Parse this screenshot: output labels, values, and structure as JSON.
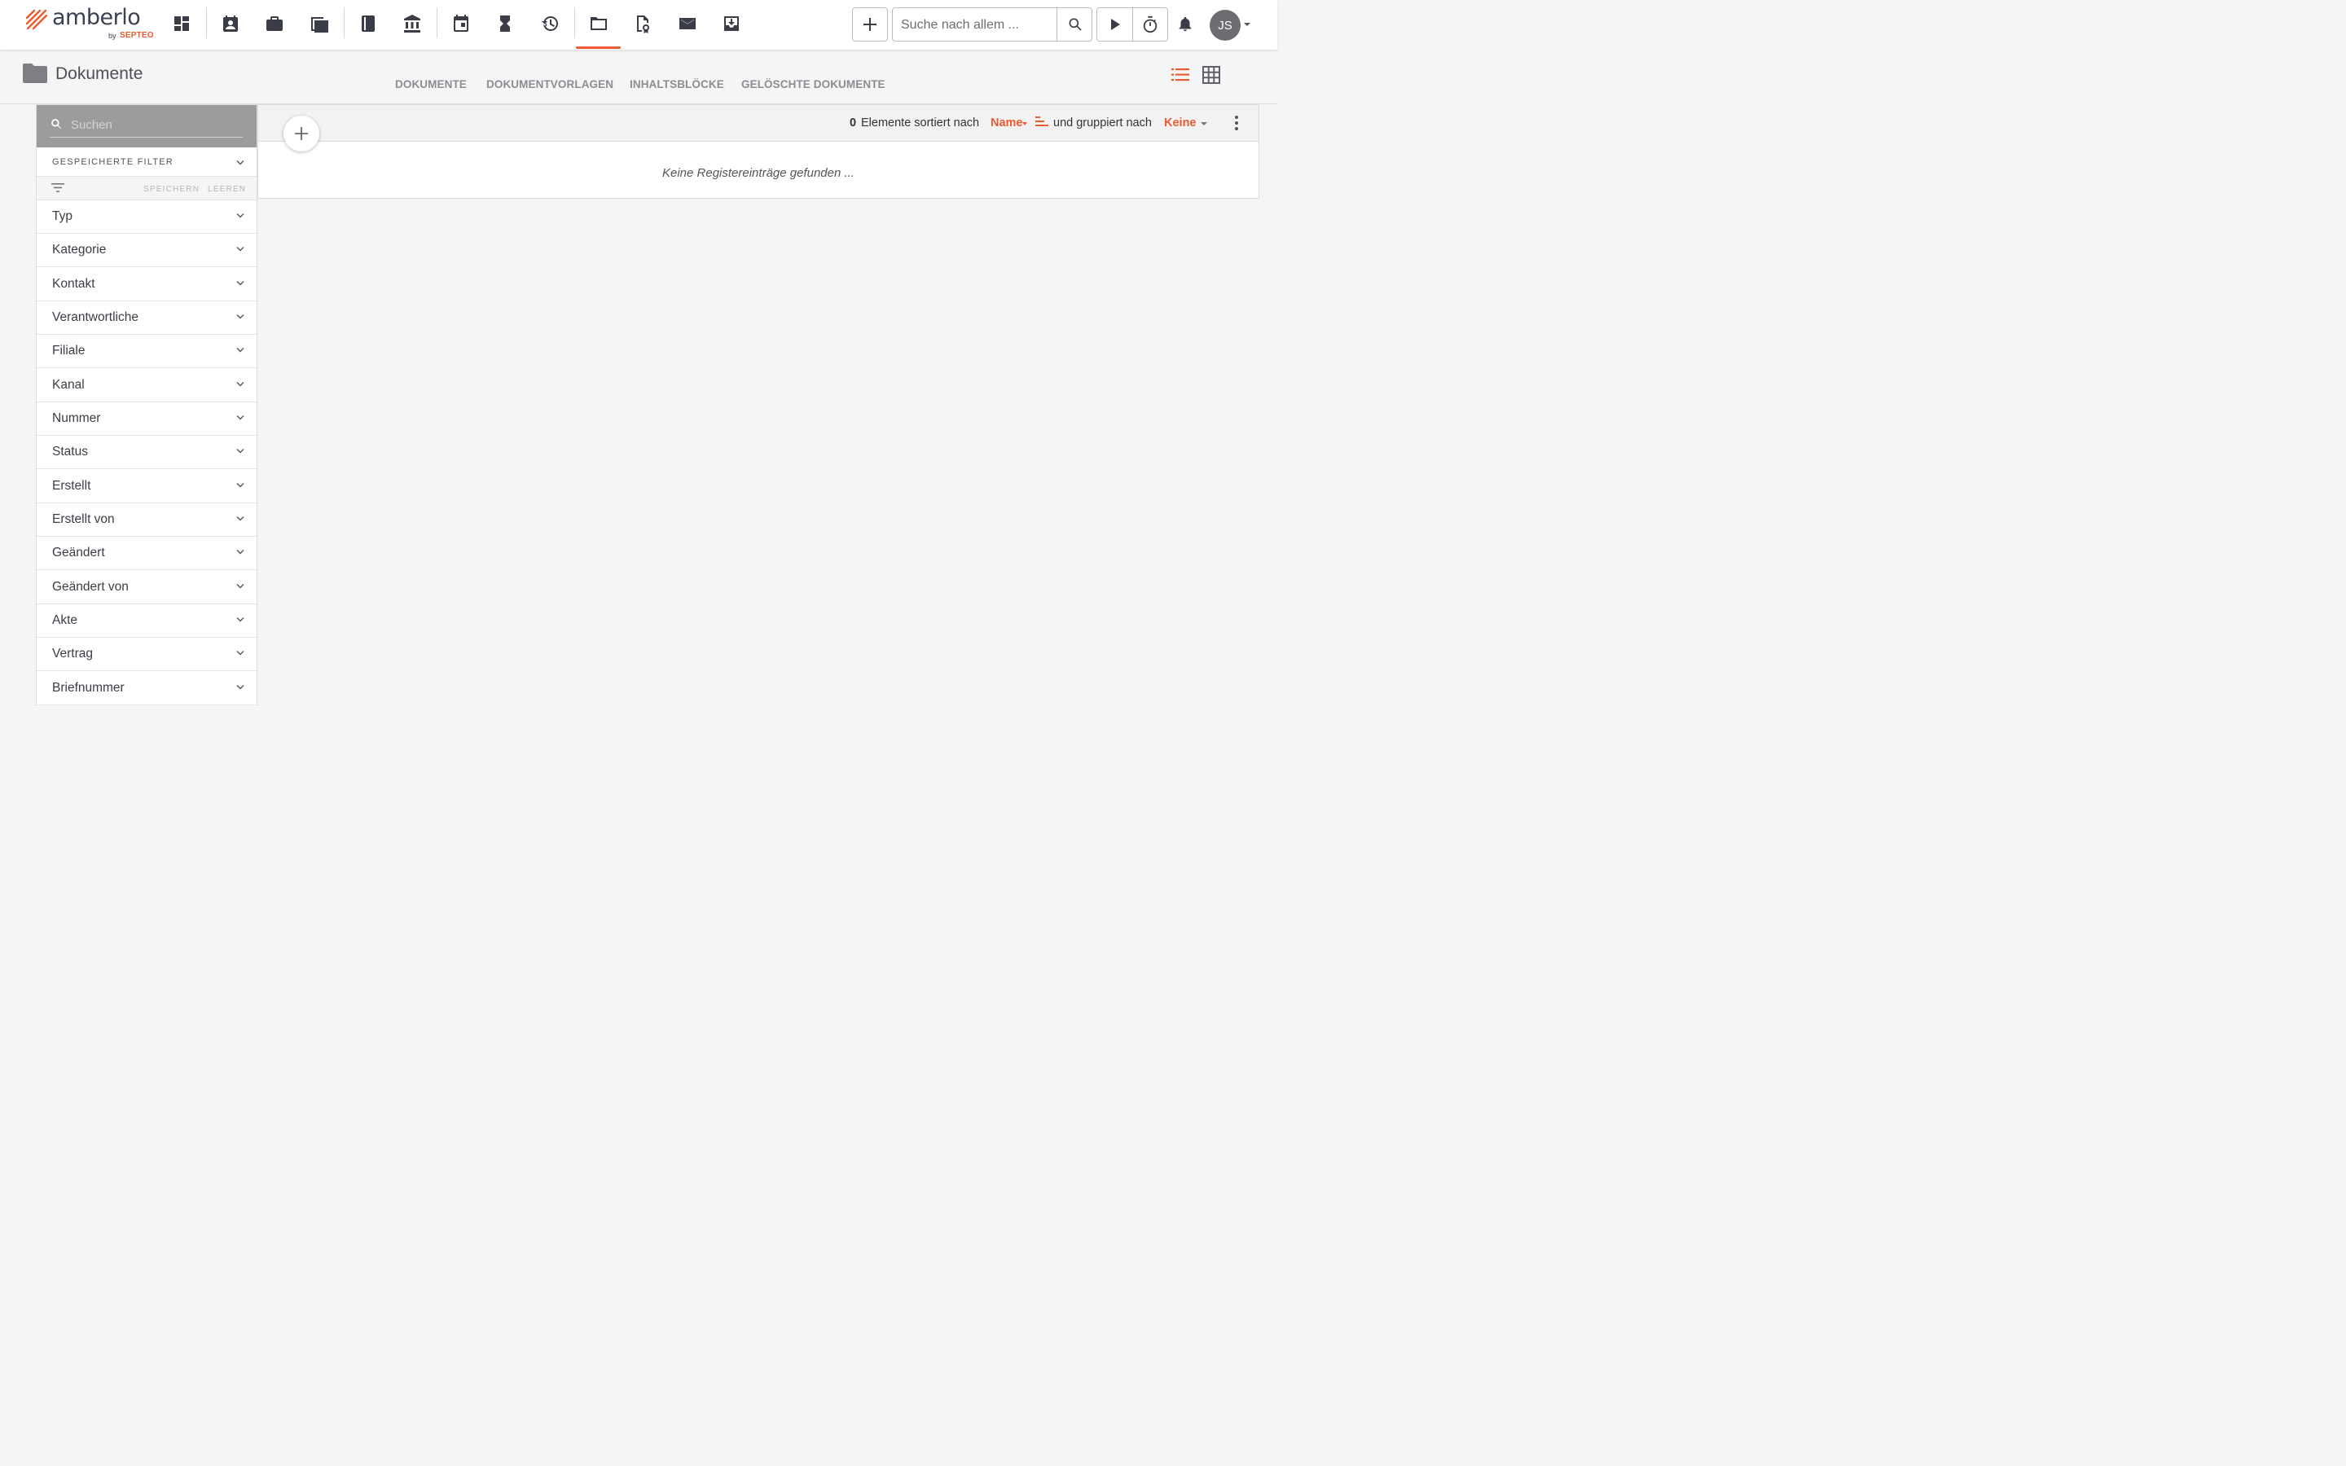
{
  "app": {
    "logo_text": "amberlo",
    "logo_by": "by",
    "logo_brand": "SEPTEO",
    "accent_color": "#ea5b2f"
  },
  "nav": {
    "icons": [
      "dashboard-icon",
      "contacts-icon",
      "matters-icon",
      "tasks-icon",
      "book-icon",
      "institution-icon",
      "calendar-icon",
      "hourglass-icon",
      "billing-history-icon",
      "documents-folder-icon",
      "document-certificate-icon",
      "mail-icon",
      "inbox-download-icon"
    ],
    "active": "documents-folder-icon"
  },
  "header_actions": {
    "search_placeholder": "Suche nach allem ...",
    "avatar_initials": "JS"
  },
  "page": {
    "title": "Dokumente",
    "tabs": [
      "DOKUMENTE",
      "DOKUMENTVORLAGEN",
      "INHALTSBLÖCKE",
      "GELÖSCHTE DOKUMENTE"
    ],
    "active_view": "list"
  },
  "sidebar": {
    "search_placeholder": "Suchen",
    "saved_filters_label": "GESPEICHERTE FILTER",
    "save_label": "SPEICHERN",
    "clear_label": "LEEREN",
    "filters": [
      "Typ",
      "Kategorie",
      "Kontakt",
      "Verantwortliche",
      "Filiale",
      "Kanal",
      "Nummer",
      "Status",
      "Erstellt",
      "Erstellt von",
      "Geändert",
      "Geändert von",
      "Akte",
      "Vertrag",
      "Briefnummer"
    ]
  },
  "list": {
    "count": "0",
    "count_suffix": "Elemente sortiert nach",
    "sort_by": "Name",
    "group_text": "und gruppiert nach",
    "group_by": "Keine",
    "empty_message": "Keine Registereinträge gefunden ..."
  }
}
